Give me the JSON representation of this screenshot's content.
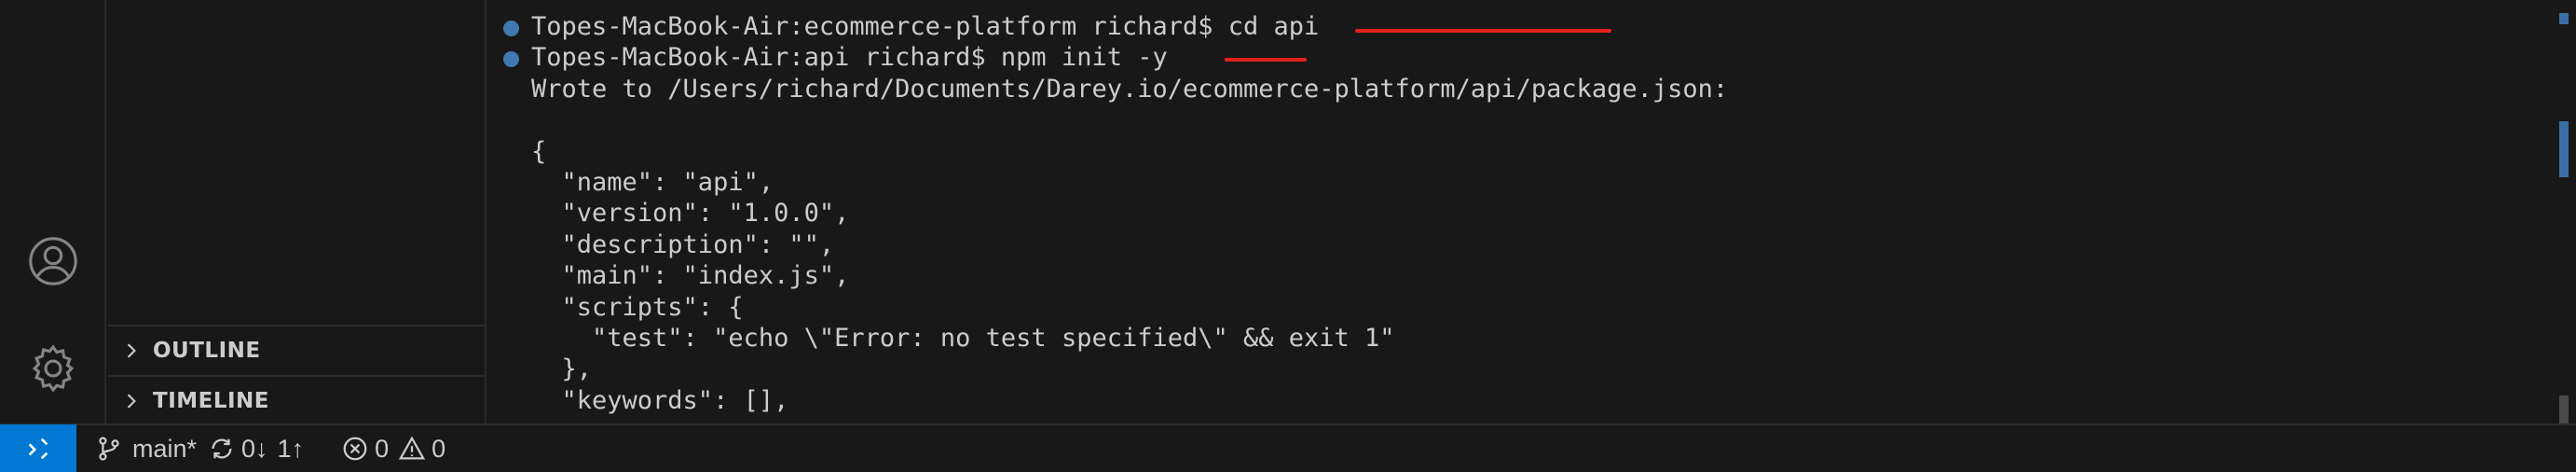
{
  "activity_bar": {
    "icons": [
      "account-icon",
      "gear-icon"
    ]
  },
  "side_panel": {
    "sections": [
      {
        "title": "OUTLINE"
      },
      {
        "title": "TIMELINE"
      }
    ]
  },
  "terminal": {
    "lines": [
      {
        "text": "Topes-MacBook-Air:ecommerce-platform richard$ cd api",
        "has_dot": true
      },
      {
        "text": "Topes-MacBook-Air:api richard$ npm init -y",
        "has_dot": true
      },
      {
        "text": "Wrote to /Users/richard/Documents/Darey.io/ecommerce-platform/api/package.json:",
        "has_dot": false
      },
      {
        "text": "",
        "has_dot": false
      },
      {
        "text": "{",
        "has_dot": false
      },
      {
        "text": "  \"name\": \"api\",",
        "has_dot": false
      },
      {
        "text": "  \"version\": \"1.0.0\",",
        "has_dot": false
      },
      {
        "text": "  \"description\": \"\",",
        "has_dot": false
      },
      {
        "text": "  \"main\": \"index.js\",",
        "has_dot": false
      },
      {
        "text": "  \"scripts\": {",
        "has_dot": false
      },
      {
        "text": "    \"test\": \"echo \\\"Error: no test specified\\\" && exit 1\"",
        "has_dot": false
      },
      {
        "text": "  },",
        "has_dot": false
      },
      {
        "text": "  \"keywords\": [],",
        "has_dot": false
      }
    ],
    "annotation_color": "#e5211c",
    "dot_color": "#3f79b1"
  },
  "status_bar": {
    "branch": "main*",
    "sync_down": "0↓",
    "sync_up": "1↑",
    "errors": "0",
    "warnings": "0",
    "remote_color": "#0078d4"
  }
}
